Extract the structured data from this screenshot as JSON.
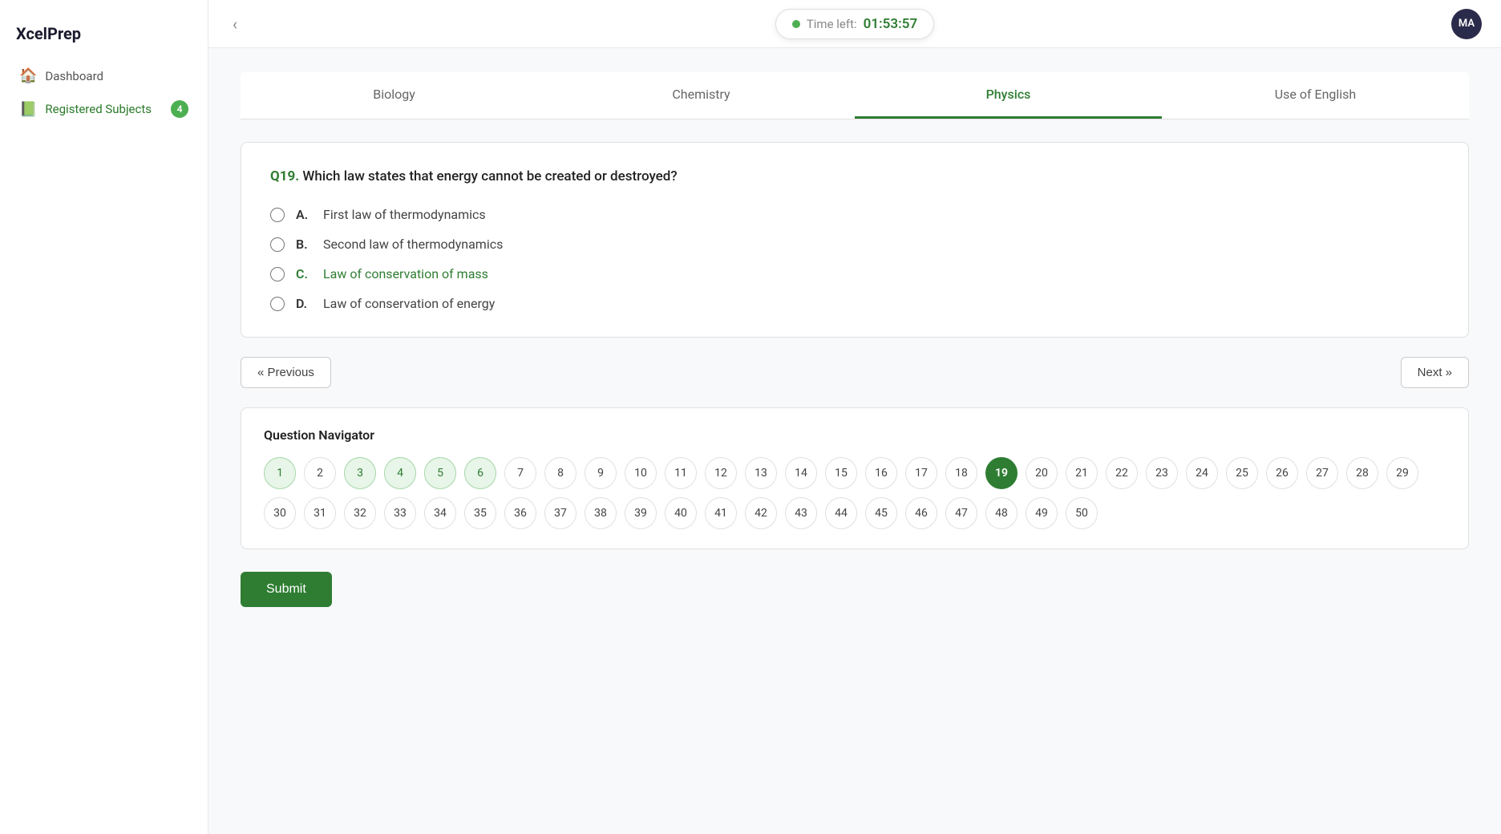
{
  "app": {
    "name": "XcelPrep",
    "avatar_initials": "MA"
  },
  "timer": {
    "label": "Time left:",
    "value": "01:53:57"
  },
  "sidebar": {
    "items": [
      {
        "id": "dashboard",
        "label": "Dashboard",
        "icon": "🏠",
        "active": false
      },
      {
        "id": "registered-subjects",
        "label": "Registered Subjects",
        "icon": "📗",
        "active": true,
        "badge": "4"
      }
    ]
  },
  "tabs": [
    {
      "id": "biology",
      "label": "Biology",
      "active": false
    },
    {
      "id": "chemistry",
      "label": "Chemistry",
      "active": false
    },
    {
      "id": "physics",
      "label": "Physics",
      "active": true
    },
    {
      "id": "use-of-english",
      "label": "Use of English",
      "active": false
    }
  ],
  "question": {
    "number": "Q19.",
    "text": "Which law states that energy cannot be created or destroyed?",
    "options": [
      {
        "letter": "A.",
        "text": "First law of thermodynamics",
        "highlighted": false
      },
      {
        "letter": "B.",
        "text": "Second law of thermodynamics",
        "highlighted": false
      },
      {
        "letter": "C.",
        "text": "Law of conservation of mass",
        "highlighted": true
      },
      {
        "letter": "D.",
        "text": "Law of conservation of energy",
        "highlighted": false
      }
    ]
  },
  "navigation": {
    "previous_label": "« Previous",
    "next_label": "Next »"
  },
  "navigator": {
    "title": "Question Navigator",
    "numbers": [
      1,
      2,
      3,
      4,
      5,
      6,
      7,
      8,
      9,
      10,
      11,
      12,
      13,
      14,
      15,
      16,
      17,
      18,
      19,
      20,
      21,
      22,
      23,
      24,
      25,
      26,
      27,
      28,
      29,
      30,
      31,
      32,
      33,
      34,
      35,
      36,
      37,
      38,
      39,
      40,
      41,
      42,
      43,
      44,
      45,
      46,
      47,
      48,
      49,
      50
    ],
    "answered": [
      1,
      3,
      4,
      5,
      6
    ],
    "current": 19
  },
  "submit": {
    "label": "Submit"
  }
}
